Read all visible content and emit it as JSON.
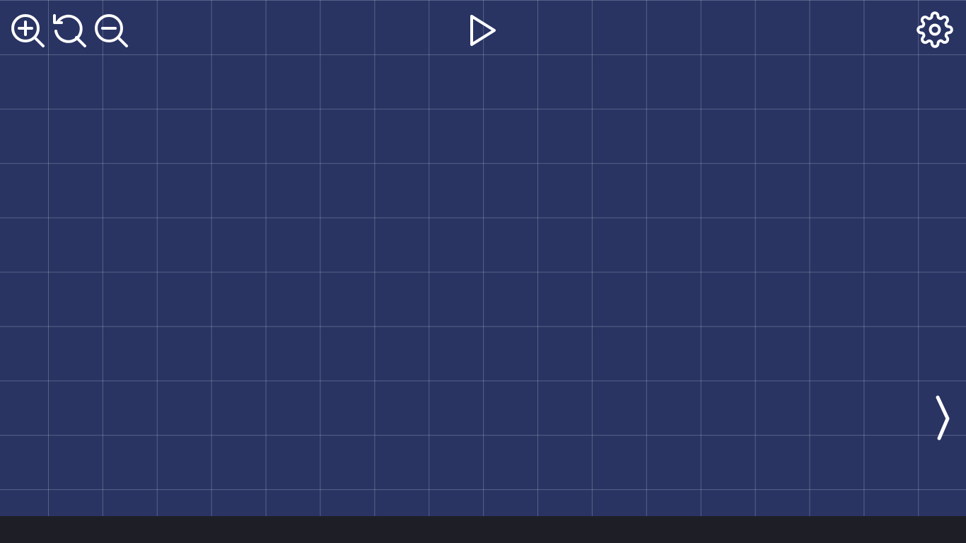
{
  "theme": {
    "canvas_background": "#293463",
    "grid_line": "#4f5a86",
    "icon_color": "#ffffff",
    "bottom_bar": "#1e1e26"
  },
  "toolbar": {
    "left": [
      {
        "name": "zoom-in-icon"
      },
      {
        "name": "reset-zoom-icon"
      },
      {
        "name": "zoom-out-icon"
      }
    ],
    "center": {
      "name": "play-icon"
    },
    "right": {
      "name": "gear-icon"
    }
  },
  "side_panel": {
    "toggle_icon": "chevron-right-icon"
  }
}
